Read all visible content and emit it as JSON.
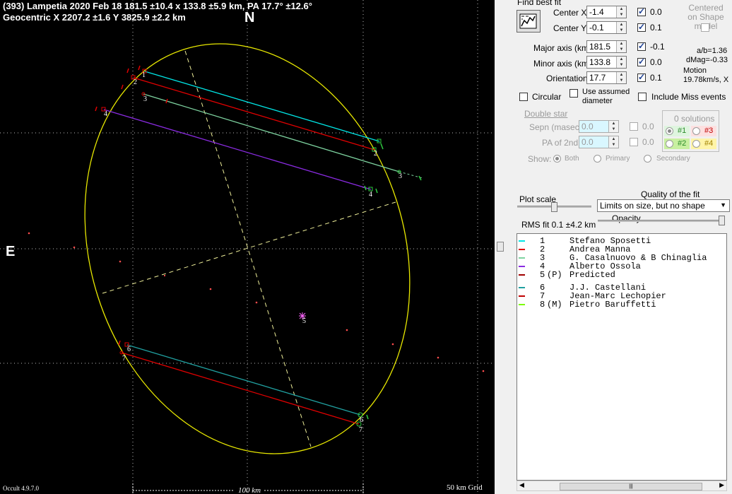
{
  "plot": {
    "title_line1": "(393) Lampetia  2020 Feb 18   181.5 ±10.4 x 133.8 ±5.9 km,  PA 17.7° ±12.6°",
    "title_line2": "Geocentric  X  2207.2 ±1.6  Y  3825.9 ±2.2 km",
    "north": "N",
    "east": "E",
    "version": "Occult 4.9.7.0",
    "scale_label": "100 km",
    "grid_label": "50 km Grid",
    "chord_labels": [
      "1",
      "2",
      "3",
      "4",
      "5",
      "6",
      "7"
    ]
  },
  "panel": {
    "find_best_fit": "Find best fit",
    "center_x": {
      "label": "Center X",
      "value": "-1.4",
      "checked": true,
      "uncert": "0.0"
    },
    "center_y": {
      "label": "Center Y",
      "value": "-0.1",
      "checked": true,
      "uncert": "0.1"
    },
    "major_axis": {
      "label": "Major axis (km)",
      "value": "181.5",
      "checked": true,
      "uncert": "-0.1"
    },
    "minor_axis": {
      "label": "Minor axis (km)",
      "value": "133.8",
      "checked": true,
      "uncert": "0.0"
    },
    "orientation": {
      "label": "Orientation",
      "value": "17.7",
      "checked": true,
      "uncert": "0.1"
    },
    "centered_on_shape": "Centered on Shape model",
    "ab_ratio": "a/b=1.36",
    "dmag": "dMag=-0.33",
    "motion": "Motion",
    "motion_value": "19.78km/s, X",
    "circular": "Circular",
    "use_assumed": "Use assumed diameter",
    "include_miss": "Include Miss events",
    "double_star": "Double star",
    "sepn": {
      "label": "Sepn (masec)",
      "value": "0.0",
      "uncert": "0.0"
    },
    "pa2": {
      "label": "PA of 2nd",
      "value": "0.0",
      "uncert": "0.0"
    },
    "show": "Show:",
    "show_options": [
      "Both",
      "Primary",
      "Secondary"
    ],
    "solutions_title": "0 solutions",
    "solutions": [
      "#1",
      "#3",
      "#2",
      "#4"
    ],
    "plot_scale": "Plot scale",
    "quality_title": "Quality of the fit",
    "quality_value": "Limits on size, but no shape",
    "opacity": "Opacity",
    "rms_fit": "RMS fit  0.1 ±4.2 km"
  },
  "legend": [
    {
      "num": "1",
      "flag": "",
      "name": "Stefano Sposetti",
      "color": "#00e5e5"
    },
    {
      "num": "2",
      "flag": "",
      "name": "Andrea Manna",
      "color": "#e00000"
    },
    {
      "num": "3",
      "flag": "",
      "name": "G. Casalnuovo & B Chinaglia",
      "color": "#7ed3a0"
    },
    {
      "num": "4",
      "flag": "",
      "name": "Alberto Ossola",
      "color": "#8a2be2"
    },
    {
      "num": "5",
      "flag": "(P)",
      "name": "Predicted",
      "color": "#a00000"
    },
    {
      "num": "6",
      "flag": "",
      "name": "J.J. Castellani",
      "color": "#20a0a0"
    },
    {
      "num": "7",
      "flag": "",
      "name": "Jean-Marc Lechopier",
      "color": "#c00000"
    },
    {
      "num": "8",
      "flag": "(M)",
      "name": "Pietro Baruffetti",
      "color": "#7cfc00"
    }
  ]
}
